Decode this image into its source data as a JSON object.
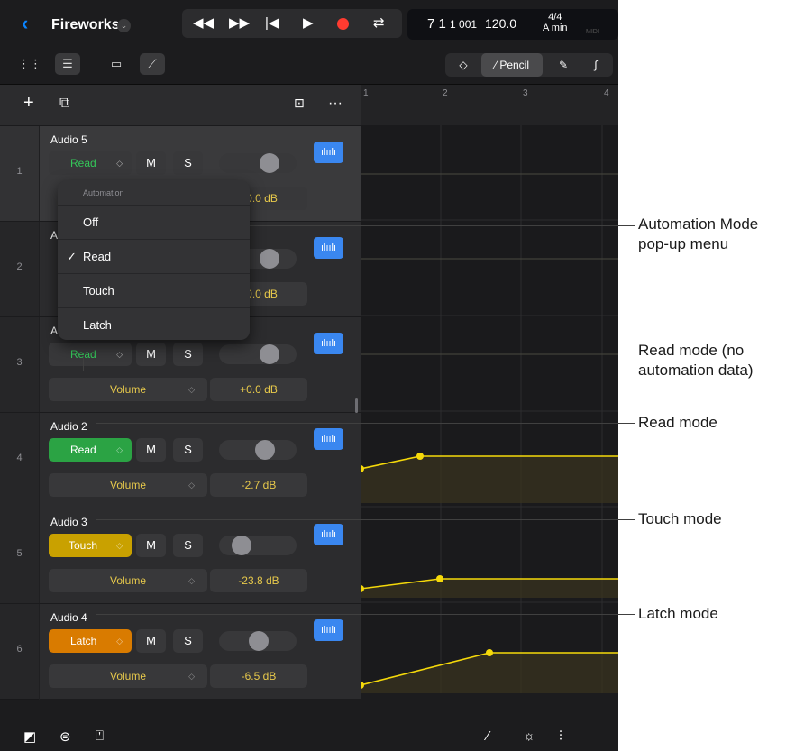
{
  "header": {
    "back_icon": "chevron-left-icon",
    "song_title": "Fireworks",
    "title_menu_icon": "chevron-down-icon",
    "transport": {
      "rewind_icon": "rewind-icon",
      "forward_icon": "fast-forward-icon",
      "to_start_icon": "go-to-beginning-icon",
      "play_icon": "play-icon",
      "record_icon": "record-icon",
      "cycle_icon": "cycle-icon"
    },
    "lcd": {
      "position_bars": "7 1",
      "position_ticks": "1 001",
      "tempo": "120.0",
      "time_signature": "4/4",
      "key": "A min",
      "midi_label": "MIDI"
    }
  },
  "toolbar": {
    "view_buttons": [
      "grid-view-icon",
      "tracks-view-icon",
      "region-view-icon",
      "automation-view-icon"
    ],
    "tools": {
      "catch_icon": "catch-icon",
      "pencil_label": "Pencil",
      "brush_icon": "brush-icon",
      "curve_icon": "curve-icon"
    }
  },
  "track_header_toolbar": {
    "add_icon": "plus-icon",
    "duplicate_icon": "duplicate-icon",
    "import_icon": "import-icon",
    "more_icon": "ellipsis-icon"
  },
  "tracks": [
    {
      "number": "1",
      "name": "Audio 5",
      "mode": "Read",
      "mute": "M",
      "solo": "S",
      "param": "",
      "value": "+0.0 dB",
      "fader": 0.7
    },
    {
      "number": "2",
      "name": "Audio",
      "mode": "",
      "mute": "",
      "solo": "",
      "param": "",
      "value": "+0.0 dB",
      "fader": 0.7
    },
    {
      "number": "3",
      "name": "Audio",
      "mode": "Read",
      "mute": "M",
      "solo": "S",
      "param": "Volume",
      "value": "+0.0 dB",
      "fader": 0.7
    },
    {
      "number": "4",
      "name": "Audio 2",
      "mode": "Read",
      "mute": "M",
      "solo": "S",
      "param": "Volume",
      "value": "-2.7 dB",
      "fader": 0.66
    },
    {
      "number": "5",
      "name": "Audio 3",
      "mode": "Touch",
      "mute": "M",
      "solo": "S",
      "param": "Volume",
      "value": "-23.8 dB",
      "fader": 0.3
    },
    {
      "number": "6",
      "name": "Audio 4",
      "mode": "Latch",
      "mute": "M",
      "solo": "S",
      "param": "Volume",
      "value": "-6.5 dB",
      "fader": 0.58
    }
  ],
  "popup": {
    "heading": "Automation",
    "items": [
      "Off",
      "Read",
      "Touch",
      "Latch"
    ],
    "selected": "Read",
    "check": "✓"
  },
  "ruler": {
    "bars": [
      "1",
      "2",
      "3",
      "4"
    ]
  },
  "bottom_bar": {
    "left_icons": [
      "loop-browser-icon",
      "toggle-icon",
      "plugin-icon"
    ],
    "right_icons": [
      "pencil-icon",
      "metronome-icon",
      "mixer-icon"
    ]
  },
  "callouts": {
    "automation_mode_menu": "Automation Mode pop-up menu",
    "automation_mode_menu_line1": "Automation Mode",
    "automation_mode_menu_line2": "pop-up menu",
    "read_no_data_line1": "Read mode (no",
    "read_no_data_line2": "automation data)",
    "read_mode": "Read mode",
    "touch_mode": "Touch mode",
    "latch_mode": "Latch mode"
  },
  "colors": {
    "read": "#2ba344",
    "touch": "#c9a100",
    "latch": "#d97b00",
    "automation_line": "#f5d90a",
    "record": "#ff3b30",
    "accent": "#0a84ff"
  }
}
